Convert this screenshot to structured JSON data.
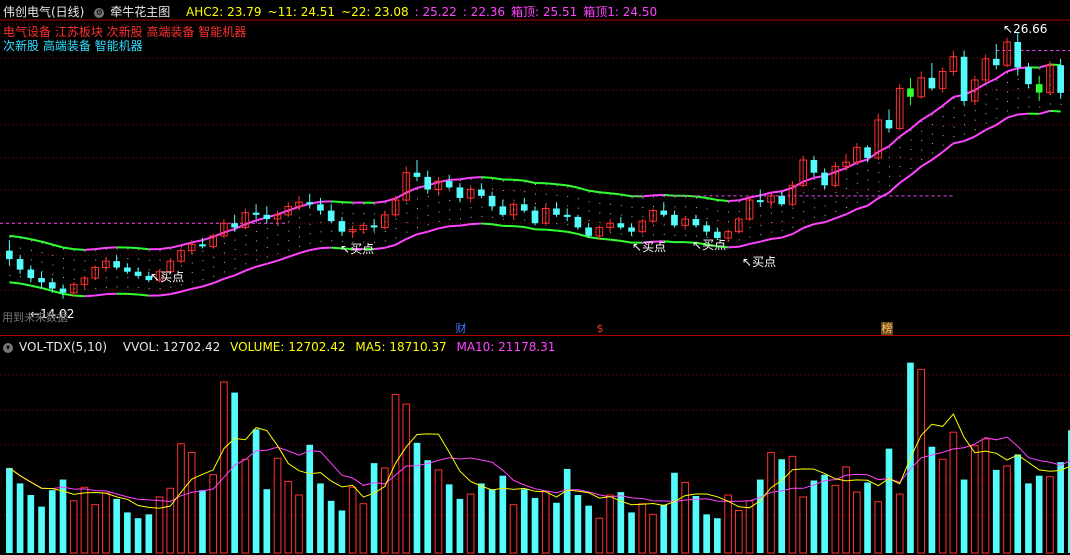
{
  "main_panel": {
    "stock_title": "伟创电气(日线)",
    "indicator_name": "牵牛花主图",
    "ahc_values": [
      {
        "label": "AHC2: 23.79",
        "color": "#ffff00"
      },
      {
        "label": "~11: 24.51",
        "color": "#ffff00"
      },
      {
        "label": "~22: 23.08",
        "color": "#ffff00"
      },
      {
        "label": ": 25.22",
        "color": "#ff44ff"
      },
      {
        "label": ": 22.36",
        "color": "#ff44ff"
      },
      {
        "label": "箱顶: 25.51",
        "color": "#ff44ff"
      },
      {
        "label": "箱顶1: 24.50",
        "color": "#ff44ff"
      }
    ],
    "concept_tags_1": "电气设备 江苏板块 次新股 高端装备 智能机器",
    "concept_tags_2": "次新股 高端装备 智能机器",
    "tag1_color": "#ff3030",
    "tag2_color": "#30e0ff",
    "high_label": "26.66",
    "low_label": "14.02",
    "watermark": "用到未来数据",
    "buy_label": "买点",
    "event_markers": [
      {
        "text": "财",
        "color": "#3a78ff"
      },
      {
        "text": "$",
        "color": "#ff3030"
      },
      {
        "text": "榜",
        "color": "#ffcc66"
      }
    ]
  },
  "volume_panel": {
    "indicator": "VOL-TDX(5,10)",
    "vvol": "VVOL: 12702.42",
    "volume": "VOLUME: 12702.42",
    "ma5": "MA5: 18710.37",
    "ma10": "MA10: 21178.31",
    "volume_color": "#ffff00",
    "ma5_color": "#ffff00",
    "ma10_color": "#ff44ff"
  },
  "colors": {
    "up": "#ff3030",
    "down": "#54fcfc",
    "green_band": "#30ff30",
    "magenta": "#ff44ff",
    "grid": "#8b0000"
  },
  "chart_data": {
    "type": "candlestick",
    "title": "伟创电气(日线)",
    "y_high": 26.66,
    "y_low": 14.02,
    "candles": [
      [
        16.3,
        16.8,
        15.6,
        15.9
      ],
      [
        15.9,
        16.1,
        15.2,
        15.4
      ],
      [
        15.4,
        15.6,
        14.8,
        15.0
      ],
      [
        15.0,
        15.3,
        14.5,
        14.8
      ],
      [
        14.8,
        15.0,
        14.3,
        14.5
      ],
      [
        14.5,
        14.7,
        14.02,
        14.3
      ],
      [
        14.3,
        14.8,
        14.1,
        14.7
      ],
      [
        14.7,
        15.1,
        14.5,
        15.0
      ],
      [
        15.0,
        15.6,
        14.9,
        15.5
      ],
      [
        15.5,
        16.0,
        15.3,
        15.8
      ],
      [
        15.8,
        16.1,
        15.4,
        15.5
      ],
      [
        15.5,
        15.7,
        15.2,
        15.3
      ],
      [
        15.3,
        15.5,
        15.0,
        15.1
      ],
      [
        15.1,
        15.3,
        14.8,
        14.9
      ],
      [
        14.9,
        15.4,
        14.8,
        15.3
      ],
      [
        15.3,
        15.9,
        15.2,
        15.8
      ],
      [
        15.8,
        16.4,
        15.7,
        16.3
      ],
      [
        16.3,
        16.8,
        16.1,
        16.6
      ],
      [
        16.6,
        16.9,
        16.4,
        16.5
      ],
      [
        16.5,
        17.1,
        16.4,
        17.0
      ],
      [
        17.0,
        17.8,
        16.9,
        17.6
      ],
      [
        17.6,
        18.0,
        17.2,
        17.4
      ],
      [
        17.4,
        18.3,
        17.3,
        18.1
      ],
      [
        18.1,
        18.5,
        17.8,
        18.0
      ],
      [
        18.0,
        18.4,
        17.6,
        17.8
      ],
      [
        17.8,
        18.2,
        17.5,
        18.0
      ],
      [
        18.0,
        18.6,
        17.9,
        18.4
      ],
      [
        18.4,
        18.9,
        18.2,
        18.6
      ],
      [
        18.6,
        19.0,
        18.3,
        18.5
      ],
      [
        18.5,
        18.8,
        18.0,
        18.2
      ],
      [
        18.2,
        18.5,
        17.6,
        17.7
      ],
      [
        17.7,
        17.9,
        17.0,
        17.2
      ],
      [
        17.2,
        17.5,
        16.9,
        17.3
      ],
      [
        17.3,
        17.6,
        17.1,
        17.5
      ],
      [
        17.5,
        17.8,
        17.2,
        17.4
      ],
      [
        17.4,
        18.2,
        17.3,
        18.0
      ],
      [
        18.0,
        18.9,
        17.9,
        18.7
      ],
      [
        18.7,
        20.3,
        18.6,
        20.0
      ],
      [
        20.0,
        20.6,
        19.6,
        19.8
      ],
      [
        19.8,
        20.1,
        19.0,
        19.2
      ],
      [
        19.2,
        19.8,
        18.9,
        19.6
      ],
      [
        19.6,
        19.9,
        19.2,
        19.3
      ],
      [
        19.3,
        19.5,
        18.6,
        18.8
      ],
      [
        18.8,
        19.4,
        18.6,
        19.2
      ],
      [
        19.2,
        19.5,
        18.8,
        18.9
      ],
      [
        18.9,
        19.1,
        18.2,
        18.4
      ],
      [
        18.4,
        18.7,
        17.9,
        18.0
      ],
      [
        18.0,
        18.6,
        17.8,
        18.5
      ],
      [
        18.5,
        18.8,
        18.1,
        18.2
      ],
      [
        18.2,
        18.4,
        17.5,
        17.6
      ],
      [
        17.6,
        18.5,
        17.5,
        18.3
      ],
      [
        18.3,
        18.6,
        17.9,
        18.0
      ],
      [
        18.0,
        18.3,
        17.7,
        17.9
      ],
      [
        17.9,
        18.0,
        17.3,
        17.4
      ],
      [
        17.4,
        17.6,
        16.9,
        17.0
      ],
      [
        17.0,
        17.5,
        16.8,
        17.4
      ],
      [
        17.4,
        17.8,
        17.2,
        17.6
      ],
      [
        17.6,
        17.9,
        17.3,
        17.4
      ],
      [
        17.4,
        17.6,
        17.0,
        17.2
      ],
      [
        17.2,
        17.8,
        17.1,
        17.7
      ],
      [
        17.7,
        18.3,
        17.6,
        18.2
      ],
      [
        18.2,
        18.6,
        17.9,
        18.0
      ],
      [
        18.0,
        18.2,
        17.4,
        17.5
      ],
      [
        17.5,
        17.9,
        17.3,
        17.8
      ],
      [
        17.8,
        18.0,
        17.4,
        17.5
      ],
      [
        17.5,
        17.7,
        17.0,
        17.2
      ],
      [
        17.2,
        17.4,
        16.8,
        16.9
      ],
      [
        16.9,
        17.3,
        16.7,
        17.2
      ],
      [
        17.2,
        17.9,
        17.1,
        17.8
      ],
      [
        17.8,
        18.9,
        17.7,
        18.7
      ],
      [
        18.7,
        19.2,
        18.4,
        18.6
      ],
      [
        18.6,
        19.0,
        18.3,
        18.9
      ],
      [
        18.9,
        19.1,
        18.4,
        18.5
      ],
      [
        18.5,
        19.6,
        18.4,
        19.4
      ],
      [
        19.4,
        20.8,
        19.3,
        20.6
      ],
      [
        20.6,
        20.8,
        19.8,
        20.0
      ],
      [
        20.0,
        20.2,
        19.2,
        19.4
      ],
      [
        19.4,
        20.5,
        19.3,
        20.3
      ],
      [
        20.3,
        20.9,
        20.1,
        20.5
      ],
      [
        20.5,
        21.4,
        20.4,
        21.2
      ],
      [
        21.2,
        21.3,
        20.5,
        20.7
      ],
      [
        20.7,
        22.8,
        20.6,
        22.5
      ],
      [
        22.5,
        23.0,
        21.9,
        22.1
      ],
      [
        22.1,
        24.2,
        22.0,
        24.0
      ],
      [
        24.0,
        24.5,
        23.2,
        23.6
      ],
      [
        23.6,
        24.8,
        23.5,
        24.5
      ],
      [
        24.5,
        25.2,
        23.9,
        24.0
      ],
      [
        24.0,
        25.0,
        23.8,
        24.8
      ],
      [
        24.8,
        25.8,
        24.6,
        25.5
      ],
      [
        25.5,
        25.8,
        23.2,
        23.4
      ],
      [
        23.4,
        24.6,
        23.2,
        24.4
      ],
      [
        24.4,
        25.6,
        24.3,
        25.4
      ],
      [
        25.4,
        26.1,
        24.9,
        25.1
      ],
      [
        25.1,
        26.4,
        25.0,
        26.2
      ],
      [
        26.2,
        26.66,
        24.6,
        25.0
      ],
      [
        25.0,
        25.2,
        24.0,
        24.2
      ],
      [
        24.2,
        24.6,
        23.4,
        23.8
      ],
      [
        23.8,
        25.3,
        23.7,
        25.1
      ],
      [
        25.1,
        25.4,
        23.5,
        23.79
      ]
    ],
    "volumes": [
      8800,
      7200,
      6000,
      4800,
      6500,
      7600,
      5400,
      6800,
      5000,
      6200,
      5600,
      4200,
      3600,
      4000,
      5800,
      6700,
      11300,
      10400,
      6500,
      8100,
      17700,
      16600,
      9700,
      12800,
      6600,
      9800,
      7400,
      6000,
      11200,
      7200,
      5400,
      4400,
      6800,
      5100,
      9300,
      8800,
      16400,
      15400,
      11400,
      9600,
      8600,
      7100,
      5600,
      6100,
      7200,
      6600,
      8000,
      5000,
      6600,
      5700,
      6400,
      5200,
      8700,
      6000,
      4900,
      3600,
      6000,
      6300,
      4200,
      5100,
      4000,
      5000,
      8300,
      7300,
      5900,
      4000,
      3600,
      6000,
      4400,
      5400,
      7600,
      10400,
      9700,
      10000,
      5800,
      7500,
      8100,
      7000,
      8900,
      6300,
      7300,
      5300,
      10800,
      6100,
      19700,
      19000,
      11000,
      9700,
      12500,
      7600,
      11100,
      11800,
      8600,
      9000,
      10200,
      7200,
      8000,
      7900,
      9400,
      12702.42
    ],
    "volume_price_scale_note": ""
  }
}
